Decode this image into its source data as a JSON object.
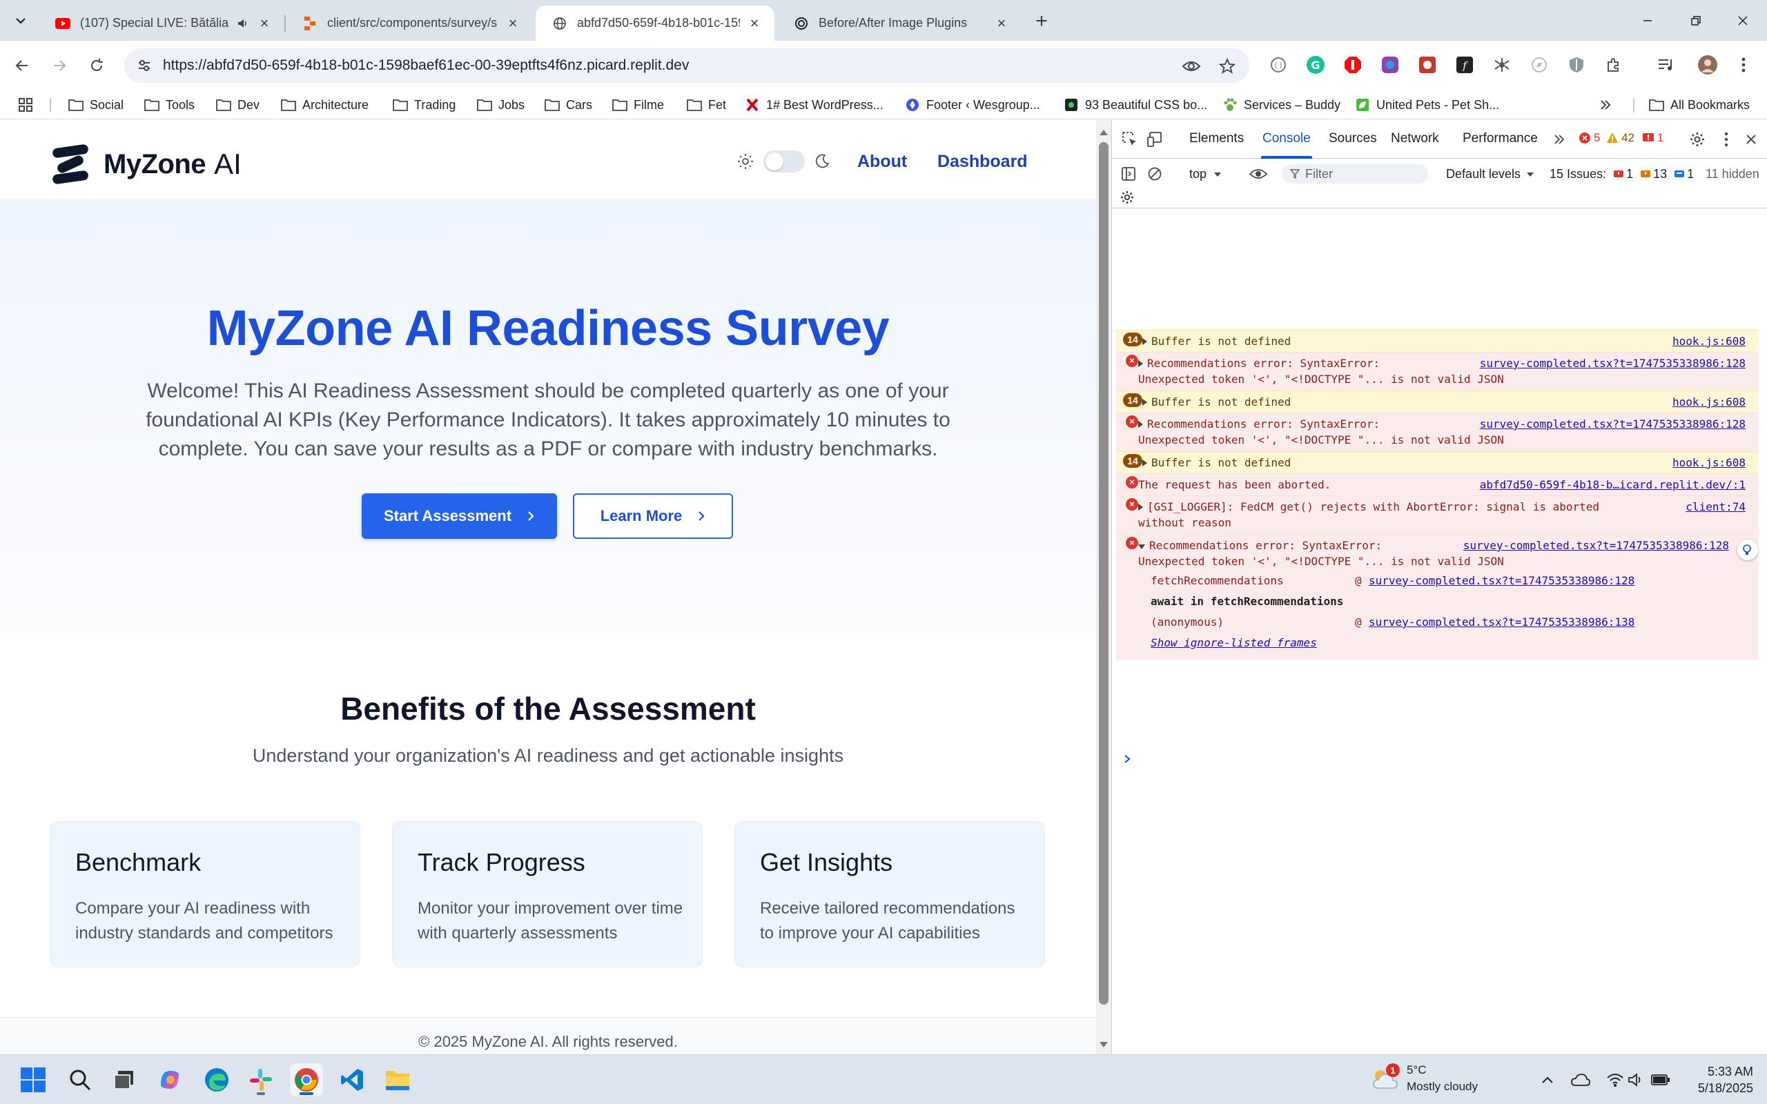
{
  "browser": {
    "tabs": [
      {
        "title": "(107) Special LIVE: Bătălia p",
        "icon": "youtube-icon",
        "active": false
      },
      {
        "title": "client/src/components/survey/s",
        "icon": "replit-icon",
        "active": false
      },
      {
        "title": "abfd7d50-659f-4b18-b01c-159",
        "icon": "globe-icon",
        "active": true
      },
      {
        "title": "Before/After Image Plugins",
        "icon": "openai-icon",
        "active": false
      }
    ],
    "url": "https://abfd7d50-659f-4b18-b01c-1598baef61ec-00-39eptfts4f6nz.picard.replit.dev",
    "bookmarks": [
      {
        "label": "Social",
        "icon": "folder-icon"
      },
      {
        "label": "Tools",
        "icon": "folder-icon"
      },
      {
        "label": "Dev",
        "icon": "folder-icon"
      },
      {
        "label": "Architecture",
        "icon": "folder-icon"
      },
      {
        "label": "Trading",
        "icon": "folder-icon"
      },
      {
        "label": "Jobs",
        "icon": "folder-icon"
      },
      {
        "label": "Cars",
        "icon": "folder-icon"
      },
      {
        "label": "Filme",
        "icon": "folder-icon"
      },
      {
        "label": "Fet",
        "icon": "folder-icon"
      },
      {
        "label": "1# Best WordPress...",
        "icon": "x-logo-icon"
      },
      {
        "label": "Footer ‹ Wesgroup...",
        "icon": "wordpress-icon"
      },
      {
        "label": "93 Beautiful CSS bo...",
        "icon": "site-icon"
      },
      {
        "label": "Services – Buddy",
        "icon": "paw-icon"
      },
      {
        "label": "United Pets - Pet Sh...",
        "icon": "leaf-icon"
      }
    ],
    "all_bookmarks": "All Bookmarks"
  },
  "page": {
    "logo_name": "MyZone",
    "logo_ai": "AI",
    "nav_about": "About",
    "nav_dashboard": "Dashboard",
    "hero_title": "MyZone AI Readiness Survey",
    "hero_subtitle": "Welcome! This AI Readiness Assessment should be completed quarterly as one of your foundational AI KPIs (Key Performance Indicators). It takes approximately 10 minutes to complete. You can save your results as a PDF or compare with industry benchmarks.",
    "btn_start": "Start Assessment",
    "btn_learn": "Learn More",
    "benefits_title": "Benefits of the Assessment",
    "benefits_subtitle": "Understand your organization's AI readiness and get actionable insights",
    "cards": [
      {
        "title": "Benchmark",
        "text": "Compare your AI readiness with industry standards and competitors"
      },
      {
        "title": "Track Progress",
        "text": "Monitor your improvement over time with quarterly assessments"
      },
      {
        "title": "Get Insights",
        "text": "Receive tailored recommendations to improve your AI capabilities"
      }
    ],
    "footer": "© 2025 MyZone AI. All rights reserved."
  },
  "devtools": {
    "tabs": [
      "Elements",
      "Console",
      "Sources",
      "Network",
      "Performance"
    ],
    "active_tab": "Console",
    "error_count": "5",
    "warning_count": "42",
    "info_count": "1",
    "context": "top",
    "filter_placeholder": "Filter",
    "levels": "Default levels",
    "issues_label": "15 Issues:",
    "issues_err": "1",
    "issues_warn": "13",
    "issues_info": "1",
    "hidden": "11 hidden",
    "messages": [
      {
        "kind": "warn",
        "count": "14",
        "lines": [
          "Buffer is not defined"
        ],
        "link": "hook.js:608"
      },
      {
        "kind": "err",
        "lines": [
          "Recommendations error: SyntaxError:",
          "Unexpected token '<', \"<!DOCTYPE \"... is not valid JSON"
        ],
        "link": "survey-completed.tsx?t=1747535338986:128"
      },
      {
        "kind": "warn",
        "count": "14",
        "lines": [
          "Buffer is not defined"
        ],
        "link": "hook.js:608"
      },
      {
        "kind": "err",
        "lines": [
          "Recommendations error: SyntaxError:",
          "Unexpected token '<', \"<!DOCTYPE \"... is not valid JSON"
        ],
        "link": "survey-completed.tsx?t=1747535338986:128"
      },
      {
        "kind": "warn",
        "count": "14",
        "lines": [
          "Buffer is not defined"
        ],
        "link": "hook.js:608"
      },
      {
        "kind": "err",
        "lines": [
          "The request has been aborted."
        ],
        "link": "abfd7d50-659f-4b18-b…icard.replit.dev/:1"
      },
      {
        "kind": "err",
        "lines": [
          "[GSI_LOGGER]: FedCM get() rejects with AbortError: signal is aborted",
          "without reason"
        ],
        "link": "client:74"
      }
    ],
    "expanded": {
      "lines": [
        "Recommendations error: SyntaxError:",
        "Unexpected token '<', \"<!DOCTYPE \"... is not valid JSON"
      ],
      "link": "survey-completed.tsx?t=1747535338986:128",
      "stack": [
        {
          "fn": "fetchRecommendations",
          "at": "@",
          "link": "survey-completed.tsx?t=1747535338986:128"
        },
        {
          "fn": "await in fetchRecommendations",
          "at": "",
          "link": ""
        },
        {
          "fn": "(anonymous)",
          "at": "@",
          "link": "survey-completed.tsx?t=1747535338986:138"
        }
      ],
      "ignore_listed": "Show ignore-listed frames"
    }
  },
  "taskbar": {
    "weather_temp": "5°C",
    "weather_desc": "Mostly cloudy",
    "weather_badge": "1",
    "time": "5:33 AM",
    "date": "5/18/2025"
  },
  "colors": {
    "brand_blue": "#2563eb",
    "hero_title": "#1d4ed8",
    "card_bg": "#eff5fe"
  }
}
